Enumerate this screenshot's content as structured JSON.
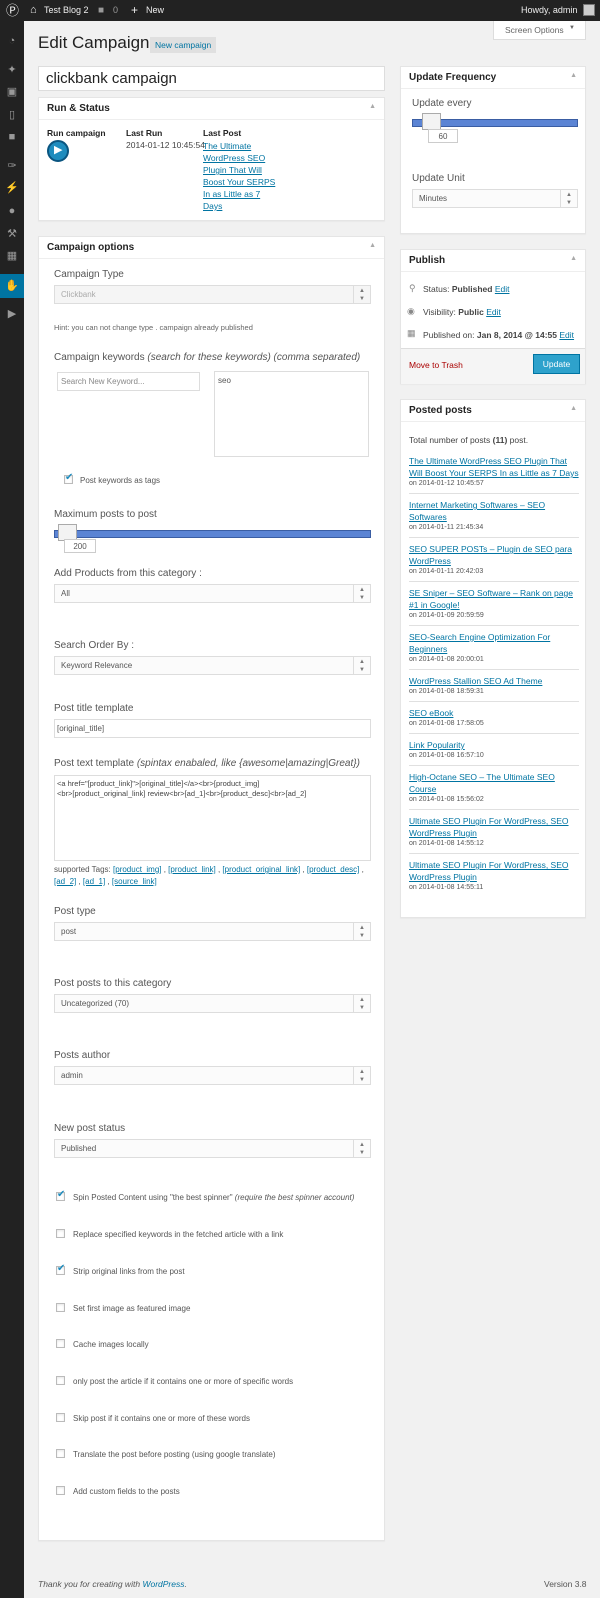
{
  "adminbar": {
    "site_name": "Test Blog 2",
    "comments_count": "0",
    "new_label": "New",
    "howdy": "Howdy, admin"
  },
  "screen_options": "Screen Options",
  "page_title": "Edit Campaign",
  "new_campaign_button": "New campaign",
  "campaign_title": "clickbank campaign",
  "run_status": {
    "heading": "Run & Status",
    "run_label": "Run campaign",
    "last_run_label": "Last Run",
    "last_run_value": "2014-01-12 10:45:54",
    "last_post_label": "Last Post",
    "last_post_lines": [
      "The Ultimate",
      "WordPress SEO",
      "Plugin That Will",
      "Boost Your SERPS",
      "In as Little as 7",
      "Days"
    ]
  },
  "options": {
    "heading": "Campaign options",
    "campaign_type_label": "Campaign Type",
    "campaign_type_value": "Clickbank",
    "hint": "Hint: you can not change type . campaign already published",
    "keywords_label": "Campaign keywords",
    "keywords_label_em": "(search for these keywords) (comma separated)",
    "keyword_placeholder": "Search New Keyword...",
    "keywords_value": "seo",
    "post_keywords_tags": "Post keywords as tags",
    "max_posts_label": "Maximum posts to post",
    "max_posts_value": "200",
    "category_label": "Add Products from this category :",
    "category_value": "All",
    "search_order_label": "Search Order By :",
    "search_order_value": "Keyword Relevance",
    "title_template_label": "Post title template",
    "title_template_value": "[original_title]",
    "text_template_label": "Post text template",
    "text_template_em": "(spintax enabaled, like {awesome|amazing|Great})",
    "text_template_line1": "<a href=\"[product_link]\">[original_title]</a><br>[product_img]",
    "text_template_line2": "<br>[product_original_link] review<br>[ad_1]<br>[product_desc]<br>[ad_2]",
    "supported_tags_label": "supported Tags:",
    "tags": [
      "[product_img]",
      "[product_link]",
      "[product_original_link]",
      "[product_desc]",
      "[ad_2]",
      "[ad_1]",
      "[source_link]"
    ],
    "post_type_label": "Post type",
    "post_type_value": "post",
    "post_category_label": "Post posts to this category",
    "post_category_value": "Uncategorized (70)",
    "author_label": "Posts author",
    "author_value": "admin",
    "status_label": "New post status",
    "status_value": "Published",
    "spin_label": "Spin Posted Content using \"the best spinner\"",
    "spin_em": "(require the best spinner account)",
    "checkboxes": [
      "Replace specified keywords in the fetched article with a link",
      "Strip original links from the post",
      "Set first image as featured image",
      "Cache images locally",
      "only post the article if it contains one or more of specific words",
      "Skip post if it contains one or more of these words",
      "Translate the post before posting (using google translate)",
      "Add custom fields to the posts"
    ]
  },
  "update_freq": {
    "heading": "Update Frequency",
    "every_label": "Update every",
    "every_value": "60",
    "unit_label": "Update Unit",
    "unit_value": "Minutes"
  },
  "publish": {
    "heading": "Publish",
    "status_label": "Status:",
    "status_value": "Published",
    "visibility_label": "Visibility:",
    "visibility_value": "Public",
    "published_label": "Published on:",
    "published_value": "Jan 8, 2014 @ 14:55",
    "edit": "Edit",
    "trash": "Move to Trash",
    "update": "Update"
  },
  "posted": {
    "heading": "Posted posts",
    "total_prefix": "Total number of posts",
    "total_count": "(11)",
    "total_suffix": "post.",
    "items": [
      {
        "title": "The Ultimate WordPress SEO Plugin That Will Boost Your SERPS In as Little as 7 Days",
        "date": "on 2014-01-12 10:45:57"
      },
      {
        "title": "Internet Marketing Softwares – SEO Softwares",
        "date": "on 2014-01-11 21:45:34"
      },
      {
        "title": "SEO SUPER POSTs – Plugin de SEO para WordPress",
        "date": "on 2014-01-11 20:42:03"
      },
      {
        "title": "SE Sniper – SEO Software – Rank on page #1 in Google!",
        "date": "on 2014-01-09 20:59:59"
      },
      {
        "title": "SEO-Search Engine Optimization For Beginners",
        "date": "on 2014-01-08 20:00:01"
      },
      {
        "title": "WordPress Stallion SEO Ad Theme",
        "date": "on 2014-01-08 18:59:31"
      },
      {
        "title": "SEO eBook",
        "date": "on 2014-01-08 17:58:05"
      },
      {
        "title": "Link Popularity",
        "date": "on 2014-01-08 16:57:10"
      },
      {
        "title": "High-Octane SEO – The Ultimate SEO Course",
        "date": "on 2014-01-08 15:56:02"
      },
      {
        "title": "Ultimate SEO Plugin For WordPress, SEO WordPress Plugin",
        "date": "on 2014-01-08 14:55:12"
      },
      {
        "title": "Ultimate SEO Plugin For WordPress, SEO WordPress Plugin",
        "date": "on 2014-01-08 14:55:11"
      }
    ]
  },
  "footer": {
    "thanks": "Thank you for creating with",
    "wp_link": "WordPress",
    "dot": ".",
    "version": "Version 3.8"
  }
}
